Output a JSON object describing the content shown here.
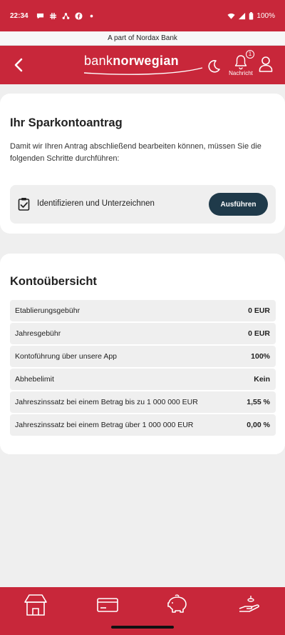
{
  "status_bar": {
    "time": "22:34",
    "battery": "100%"
  },
  "banner": {
    "text": "A part of Nordax Bank"
  },
  "header": {
    "brand_light": "bank",
    "brand_bold": "norwegian",
    "notification_badge": "1",
    "notification_label": "Nachricht"
  },
  "application": {
    "title": "Ihr Sparkontoantrag",
    "description": "Damit wir Ihren Antrag abschließend bearbeiten können, müssen Sie die folgenden Schritte durchführen:",
    "step_label": "Identifizieren und Unterzeichnen",
    "step_button": "Ausführen"
  },
  "overview": {
    "title": "Kontoübersicht",
    "rows": [
      {
        "label": "Etablierungsgebühr",
        "value": "0 EUR"
      },
      {
        "label": "Jahresgebühr",
        "value": "0 EUR"
      },
      {
        "label": "Kontoführung über unsere App",
        "value": "100%"
      },
      {
        "label": "Abhebelimit",
        "value": "Kein"
      },
      {
        "label": "Jahreszinssatz bei einem Betrag bis zu 1 000 000 EUR",
        "value": "1,55 %"
      },
      {
        "label": "Jahreszinssatz bei einem Betrag über 1 000 000 EUR",
        "value": "0,00 %"
      }
    ]
  },
  "bottom_nav": {
    "items": [
      "home-icon",
      "card-icon",
      "piggy-bank-icon",
      "hand-coin-icon"
    ]
  },
  "colors": {
    "brand_red": "#c8273a",
    "button_dark": "#1f3a4a",
    "background": "#efefef"
  }
}
